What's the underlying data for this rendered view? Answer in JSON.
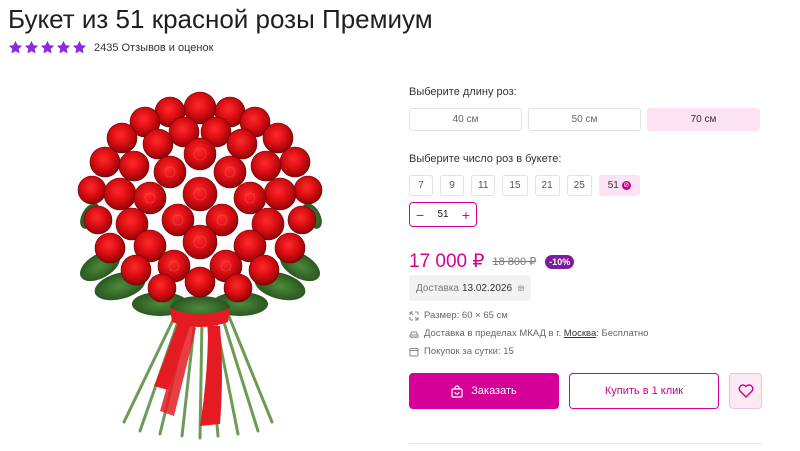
{
  "product": {
    "title": "Букет из 51 красной розы Премиум",
    "rating_stars": 5,
    "reviews": "2435 Отзывов и оценок"
  },
  "options": {
    "length_label": "Выберите длину роз:",
    "lengths": [
      "40 см",
      "50 см",
      "70 см"
    ],
    "selected_length": "70 см",
    "count_label": "Выберите число роз в букете:",
    "counts": [
      "7",
      "9",
      "11",
      "15",
      "21",
      "25",
      "51"
    ],
    "selected_count": "51",
    "stepper_value": "51",
    "stepper_minus": "−",
    "stepper_plus": "+"
  },
  "pricing": {
    "price": "17 000 ₽",
    "old_price": "18 800 ₽",
    "discount": "-10%"
  },
  "delivery": {
    "label": "Доставка",
    "date": "13.02.2026"
  },
  "details": {
    "size": "Размер: 60 × 65 см",
    "delivery_prefix": "Доставка в пределах МКАД в г.",
    "delivery_city": "Москва",
    "delivery_suffix": ": Бесплатно",
    "purchases": "Покупок за сутки: 15"
  },
  "actions": {
    "order": "Заказать",
    "one_click": "Купить в 1 клик"
  },
  "colors": {
    "accent": "#d40097",
    "star": "#8a2be2",
    "discount_bg": "#7e1b9f",
    "selected_bg": "#fbe3f3"
  }
}
